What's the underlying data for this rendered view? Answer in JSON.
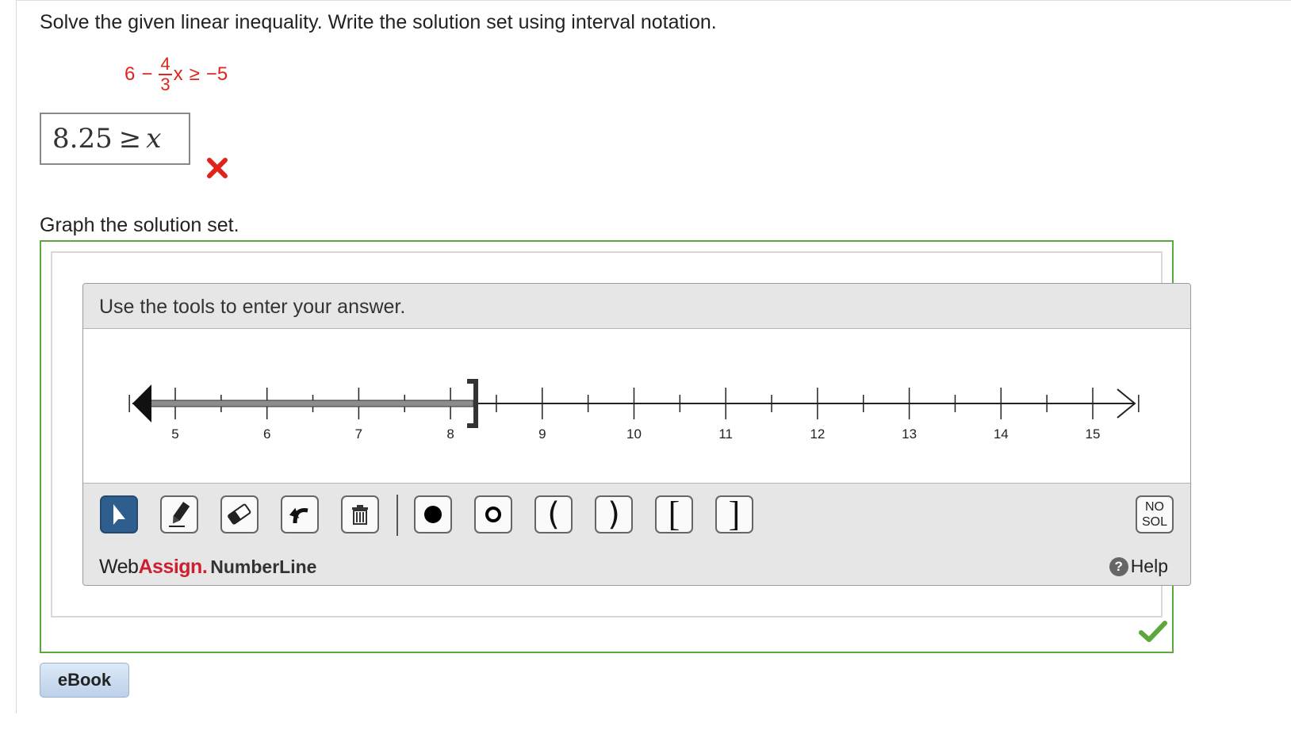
{
  "question": {
    "instruction": "Solve the given linear inequality. Write the solution set using interval notation.",
    "inequality": {
      "left_const": "6",
      "minus": "−",
      "frac_num": "4",
      "frac_den": "3",
      "var": "x",
      "relation": "≥",
      "right": "−5"
    },
    "answer": {
      "value": "8.25",
      "relation": "≥",
      "var": "x"
    },
    "answer_status": "incorrect"
  },
  "graph": {
    "label": "Graph the solution set.",
    "header": "Use the tools to enter your answer.",
    "number_line": {
      "ticks": [
        "5",
        "6",
        "7",
        "8",
        "9",
        "10",
        "11",
        "12",
        "13",
        "14",
        "15"
      ],
      "min": 4.5,
      "max": 15.5,
      "shaded_from": "-infinity",
      "shaded_to": 8.25,
      "endpoint": {
        "value": 8.25,
        "type": "closed-bracket"
      }
    },
    "tools": [
      {
        "name": "pointer-tool",
        "icon": "cursor-arrow-icon",
        "active": true
      },
      {
        "name": "pencil-tool",
        "icon": "pencil-icon"
      },
      {
        "name": "eraser-tool",
        "icon": "eraser-icon"
      },
      {
        "name": "undo-tool",
        "icon": "undo-icon"
      },
      {
        "name": "trash-tool",
        "icon": "trash-icon"
      },
      {
        "name": "closed-dot-tool",
        "icon": "filled-circle-icon"
      },
      {
        "name": "open-dot-tool",
        "icon": "open-circle-icon"
      },
      {
        "name": "left-paren-tool",
        "glyph": "("
      },
      {
        "name": "right-paren-tool",
        "glyph": ")"
      },
      {
        "name": "left-bracket-tool",
        "glyph": "["
      },
      {
        "name": "right-bracket-tool",
        "glyph": "]"
      }
    ],
    "no_solution": {
      "line1": "NO",
      "line2": "SOL"
    },
    "brand": {
      "web": "Web",
      "assign": "Assign",
      "dot": ".",
      "product": "NumberLine"
    },
    "help": "Help",
    "graph_status": "correct"
  },
  "ebook": "eBook",
  "colors": {
    "red": "#e0241b",
    "green": "#5da83c",
    "toolbar_bg": "#e6e6e6",
    "active_tool": "#2e5e8e"
  }
}
